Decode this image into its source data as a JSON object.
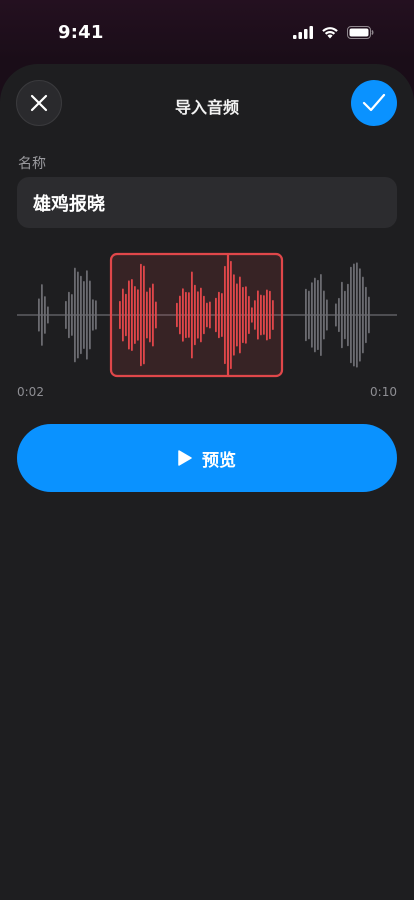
{
  "status_bar": {
    "time": "9:41"
  },
  "header": {
    "title": "导入音频",
    "close_icon": "close-icon",
    "confirm_icon": "checkmark-icon"
  },
  "name_field": {
    "label": "名称",
    "value": "雄鸡报晓"
  },
  "waveform": {
    "start_time": "0:02",
    "end_time": "0:10",
    "selection_color": "#e0474a",
    "inactive_color": "#6b6b70"
  },
  "preview": {
    "label": "预览",
    "icon": "play-icon"
  },
  "colors": {
    "accent": "#0a92ff",
    "sheet": "#1e1e20",
    "input_bg": "#2c2c2f"
  }
}
